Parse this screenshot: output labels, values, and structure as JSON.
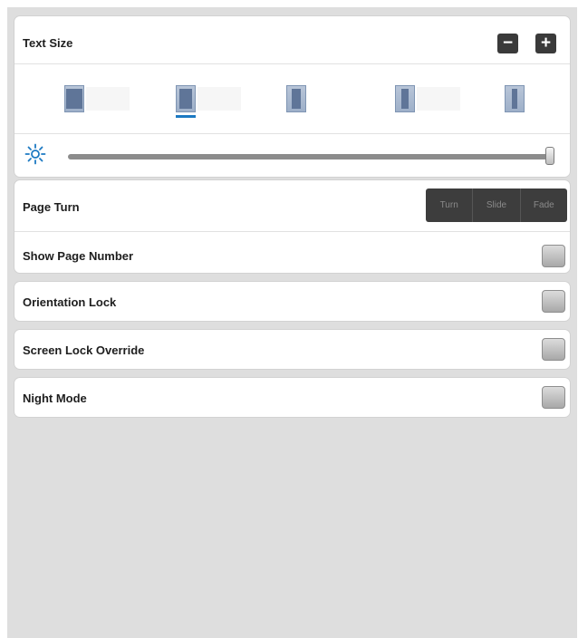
{
  "text_size": {
    "label": "Text Size",
    "decrease_symbol": "−",
    "increase_symbol": "+",
    "selected_margin_index": 1
  },
  "brightness": {
    "icon": "sun-icon",
    "level": 1.0
  },
  "page_turn": {
    "label": "Page Turn",
    "options": [
      "Turn",
      "Slide",
      "Fade"
    ]
  },
  "toggles": [
    {
      "label": "Show Page Number",
      "checked": false
    },
    {
      "label": "Orientation Lock",
      "checked": false
    },
    {
      "label": "Screen Lock Override",
      "checked": false
    },
    {
      "label": "Night Mode",
      "checked": false
    }
  ],
  "colors": {
    "accent": "#1c79c2",
    "background": "#dedede",
    "button_dark": "#3a3a3a"
  }
}
